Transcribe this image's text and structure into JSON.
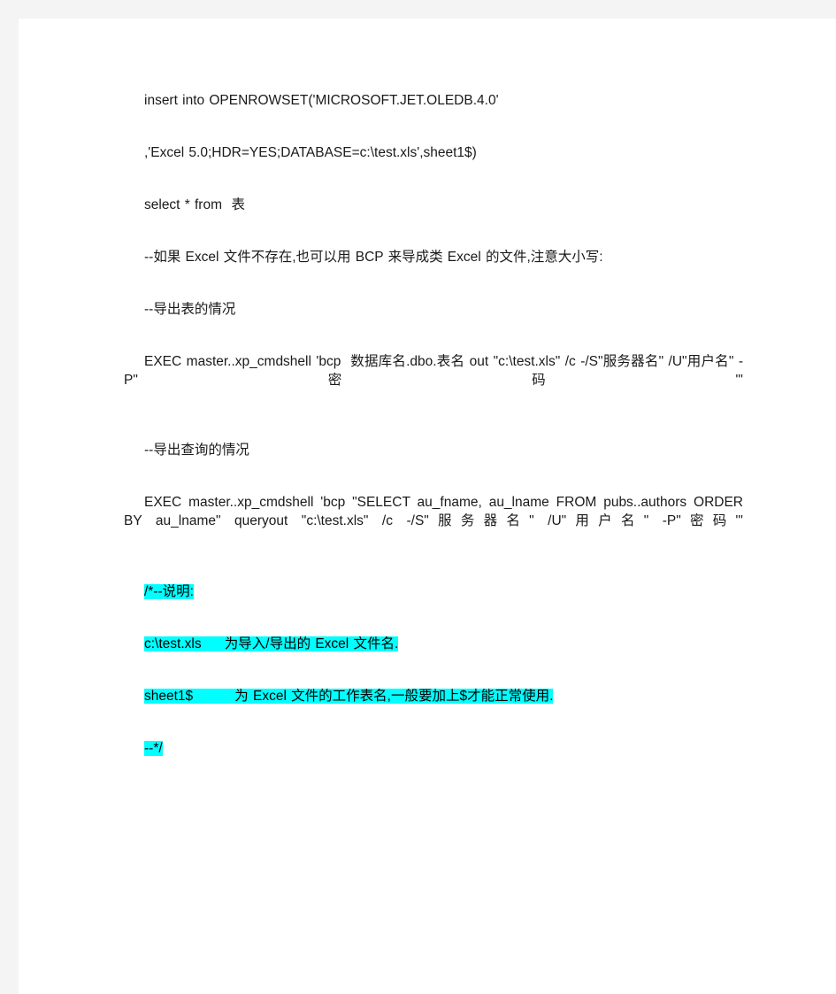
{
  "document": {
    "page_background": "#ffffff",
    "canvas_background": "#f4f4f4",
    "highlight_color": "#00ffff",
    "text_color": "#1a1a1a",
    "paragraphs": [
      {
        "id": "p1",
        "text": "insert into OPENROWSET('MICROSOFT.JET.OLEDB.4.0'",
        "highlight": false,
        "indent": true
      },
      {
        "id": "p2",
        "text": ",'Excel 5.0;HDR=YES;DATABASE=c:\\test.xls',sheet1$)",
        "highlight": false,
        "indent": true
      },
      {
        "id": "p3",
        "text": "select * from  表",
        "highlight": false,
        "indent": true
      },
      {
        "id": "p4",
        "text": "--如果 Excel 文件不存在,也可以用 BCP 来导成类 Excel 的文件,注意大小写:",
        "highlight": false,
        "indent": true
      },
      {
        "id": "p5",
        "text": "--导出表的情况",
        "highlight": false,
        "indent": true
      },
      {
        "id": "p6",
        "text": "EXEC master..xp_cmdshell 'bcp  数据库名.dbo.表名 out \"c:\\test.xls\" /c -/S\"服务器名\" /U\"用户名\" -P\"密码\"'",
        "highlight": false,
        "indent": true,
        "justify": true
      },
      {
        "id": "p7",
        "text": "--导出查询的情况",
        "highlight": false,
        "indent": true
      },
      {
        "id": "p8",
        "text": "EXEC master..xp_cmdshell 'bcp \"SELECT au_fname, au_lname FROM pubs..authors ORDER BY au_lname\" queryout \"c:\\test.xls\" /c -/S\"服务器名\" /U\"用户名\" -P\"密码\"'",
        "highlight": false,
        "indent": true,
        "justify": true
      },
      {
        "id": "p9",
        "text": "/*--说明:",
        "highlight": true,
        "indent": true
      },
      {
        "id": "p10",
        "text": "c:\\test.xls     为导入/导出的 Excel 文件名.",
        "highlight": true,
        "indent": true
      },
      {
        "id": "p11",
        "text": "sheet1$         为 Excel 文件的工作表名,一般要加上$才能正常使用.",
        "highlight": true,
        "indent": true
      },
      {
        "id": "p12",
        "text": "--*/",
        "highlight": true,
        "indent": true
      }
    ]
  }
}
